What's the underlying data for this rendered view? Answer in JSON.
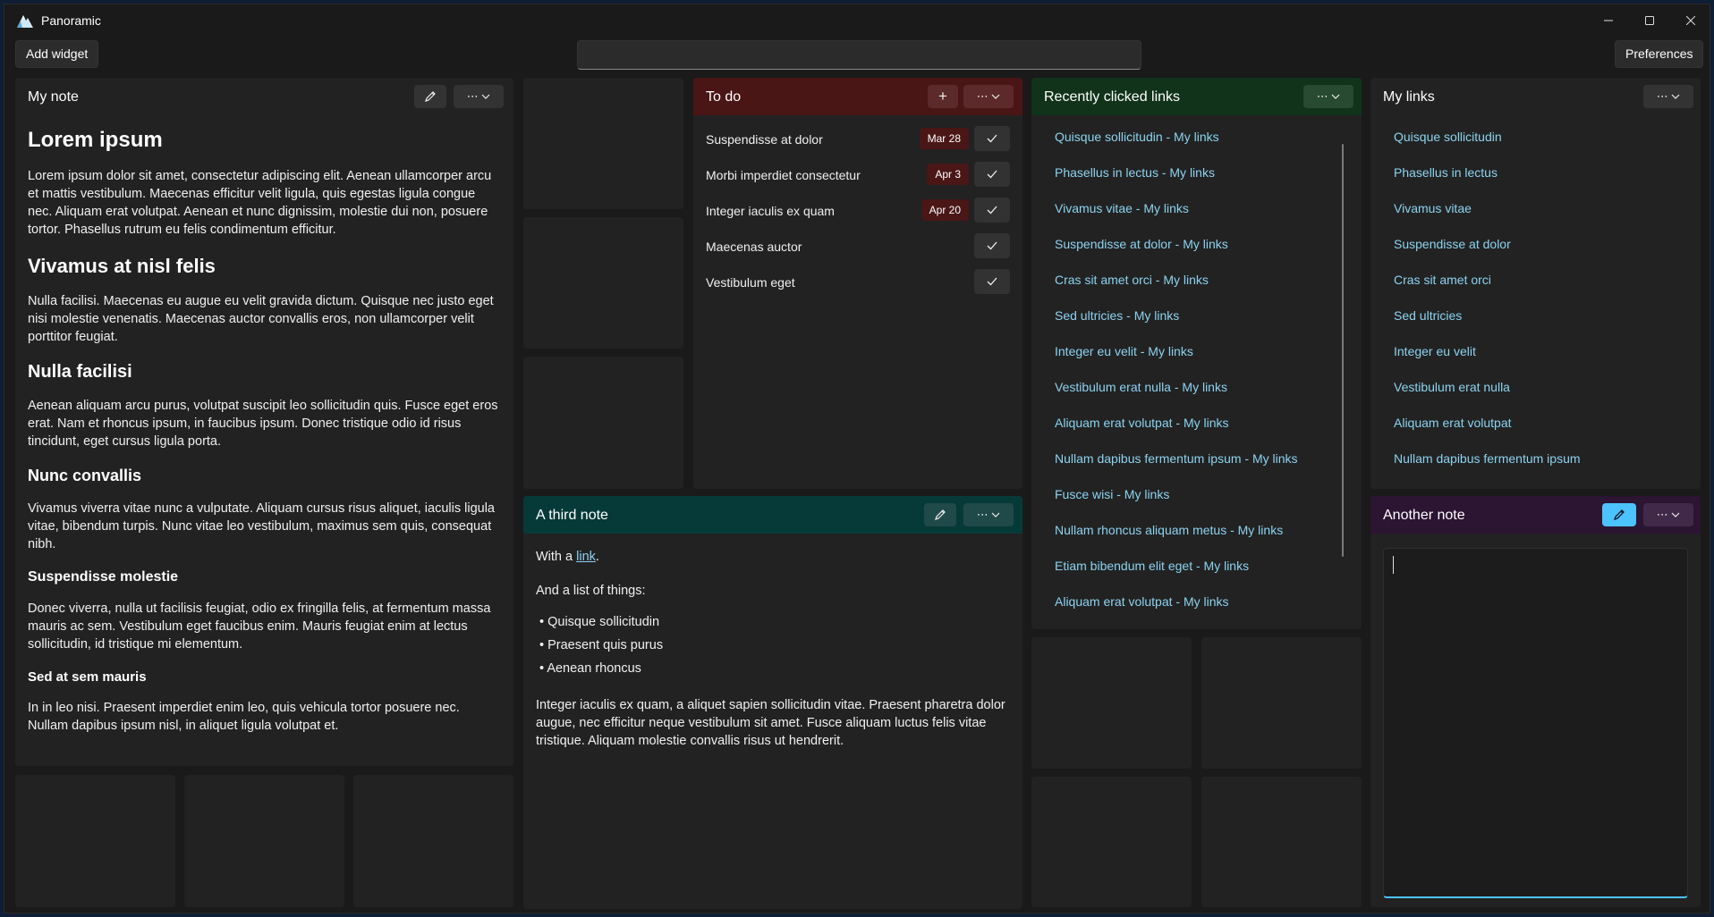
{
  "app": {
    "title": "Panoramic"
  },
  "toolbar": {
    "add_widget_label": "Add widget",
    "search_value": "",
    "preferences_label": "Preferences"
  },
  "colors": {
    "todo_header": "#4a1515",
    "third_note_header": "#063a39",
    "recent_links_header": "#10331a",
    "another_note_header": "#2c1433",
    "link": "#8cd3f0",
    "accent": "#4cc2ff"
  },
  "my_note": {
    "title": "My note",
    "content": {
      "h1": "Lorem ipsum",
      "p1": "Lorem ipsum dolor sit amet, consectetur adipiscing elit. Aenean ullamcorper arcu et mattis vestibulum. Maecenas efficitur velit ligula, quis egestas ligula congue nec. Aliquam erat volutpat. Aenean et nunc dignissim, molestie dui non, posuere tortor. Phasellus rutrum eu felis condimentum efficitur.",
      "h2": "Vivamus at nisl felis",
      "p2": "Nulla facilisi. Maecenas eu augue eu velit gravida dictum. Quisque nec justo eget nisi molestie venenatis. Maecenas auctor convallis eros, non ullamcorper velit porttitor feugiat.",
      "h3": "Nulla facilisi",
      "p3": "Aenean aliquam arcu purus, volutpat suscipit leo sollicitudin quis. Fusce eget eros erat. Nam et rhoncus ipsum, in faucibus ipsum. Donec tristique odio id risus tincidunt, eget cursus ligula porta.",
      "h4": "Nunc convallis",
      "p4": "Vivamus viverra vitae nunc a vulputate. Aliquam cursus risus aliquet, iaculis ligula vitae, bibendum turpis. Nunc vitae leo vestibulum, maximus sem quis, consequat nibh.",
      "h5": "Suspendisse molestie",
      "p5": "Donec viverra, nulla ut facilisis feugiat, odio ex fringilla felis, at fermentum massa mauris ac sem. Vestibulum eget faucibus enim. Mauris feugiat enim at lectus sollicitudin, id tristique mi elementum.",
      "h6": "Sed at sem mauris",
      "p6": "In in leo nisi. Praesent imperdiet enim leo, quis vehicula tortor posuere nec. Nullam dapibus ipsum nisl, in aliquet ligula volutpat et."
    }
  },
  "todo": {
    "title": "To do",
    "items": [
      {
        "text": "Suspendisse at dolor",
        "due": "Mar 28"
      },
      {
        "text": "Morbi imperdiet consectetur",
        "due": "Apr 3"
      },
      {
        "text": "Integer iaculis ex quam",
        "due": "Apr 20"
      },
      {
        "text": "Maecenas auctor",
        "due": ""
      },
      {
        "text": "Vestibulum eget",
        "due": ""
      }
    ]
  },
  "recent_links": {
    "title": "Recently clicked links",
    "items": [
      "Quisque sollicitudin - My links",
      "Phasellus in lectus - My links",
      "Vivamus vitae - My links",
      "Suspendisse at dolor - My links",
      "Cras sit amet orci - My links",
      "Sed ultricies - My links",
      "Integer eu velit - My links",
      "Vestibulum erat nulla - My links",
      "Aliquam erat volutpat - My links",
      "Nullam dapibus fermentum ipsum - My links",
      "Fusce wisi - My links",
      "Nullam rhoncus aliquam metus - My links",
      "Etiam bibendum elit eget - My links",
      "Aliquam erat volutpat - My links"
    ]
  },
  "my_links": {
    "title": "My links",
    "items": [
      "Quisque sollicitudin",
      "Phasellus in lectus",
      "Vivamus vitae",
      "Suspendisse at dolor",
      "Cras sit amet orci",
      "Sed ultricies",
      "Integer eu velit",
      "Vestibulum erat nulla",
      "Aliquam erat volutpat",
      "Nullam dapibus fermentum ipsum"
    ]
  },
  "third_note": {
    "title": "A third note",
    "with_a": "With a ",
    "link_text": "link",
    "period": ".",
    "list_intro": "And a list of things:",
    "list": [
      "Quisque sollicitudin",
      "Praesent quis purus",
      "Aenean rhoncus"
    ],
    "bullet": "•",
    "paragraph": "Integer iaculis ex quam, a aliquet sapien sollicitudin vitae. Praesent pharetra dolor augue, nec efficitur neque vestibulum sit amet. Fusce aliquam luctus felis vitae tristique. Aliquam molestie convallis risus ut hendrerit."
  },
  "another_note": {
    "title": "Another note",
    "value": ""
  },
  "icons": {
    "more": "⋯",
    "chevron": "⌄",
    "plus": "+",
    "minimize": "—",
    "close": "✕"
  }
}
